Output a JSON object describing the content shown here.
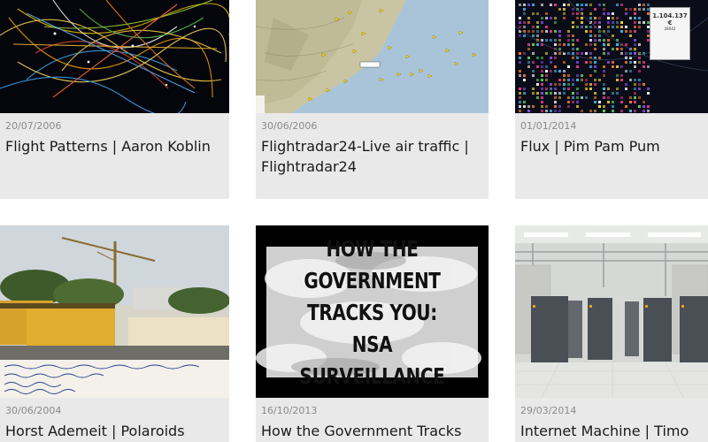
{
  "cards": [
    {
      "id": "flight-patterns",
      "date": "20/07/2006",
      "title": "Flight Patterns | Aaron Koblin",
      "thumb_icon": "flight-paths-map-image"
    },
    {
      "id": "flightradar24",
      "date": "30/06/2006",
      "title": "Flightradar24-Live air traffic | Flightradar24",
      "thumb_icon": "air-traffic-map-image"
    },
    {
      "id": "flux",
      "date": "01/01/2014",
      "title": "Flux | Pim Pam Pum",
      "thumb_icon": "data-visualization-image",
      "overlay_value": "1.104.137 €",
      "overlay_sub": "28042"
    },
    {
      "id": "horst-ademeit",
      "date": "30/06/2004",
      "title": "Horst Ademeit | Polaroids",
      "thumb_icon": "polaroid-photo-image"
    },
    {
      "id": "nsa-surveillance",
      "date": "16/10/2013",
      "title": "How the Government Tracks",
      "thumb_icon": "video-title-image",
      "thumb_text": [
        "HOW THE GOVERNMENT",
        "TRACKS YOU:",
        "NSA SURVEILLANCE"
      ]
    },
    {
      "id": "internet-machine",
      "date": "29/03/2014",
      "title": "Internet Machine | Timo",
      "thumb_icon": "server-room-image"
    }
  ],
  "colors": {
    "card_bg": "#e9e9e9",
    "date_text": "#8a8a8a",
    "title_text": "#1a1a1a"
  }
}
